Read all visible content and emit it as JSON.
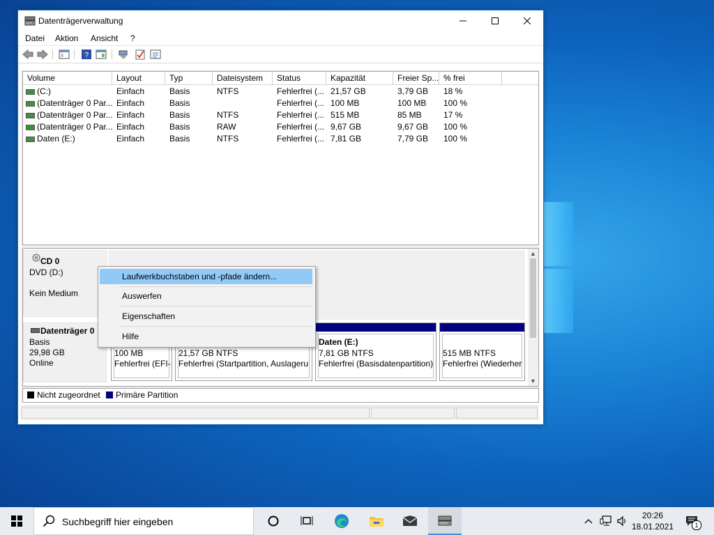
{
  "window": {
    "title": "Datenträgerverwaltung",
    "menu": [
      "Datei",
      "Aktion",
      "Ansicht",
      "?"
    ]
  },
  "volumes": {
    "columns": [
      "Volume",
      "Layout",
      "Typ",
      "Dateisystem",
      "Status",
      "Kapazität",
      "Freier Sp...",
      "% frei"
    ],
    "rows": [
      [
        "(C:)",
        "Einfach",
        "Basis",
        "NTFS",
        "Fehlerfrei (...",
        "21,57 GB",
        "3,79 GB",
        "18 %"
      ],
      [
        "(Datenträger 0 Par...",
        "Einfach",
        "Basis",
        "",
        "Fehlerfrei (...",
        "100 MB",
        "100 MB",
        "100 %"
      ],
      [
        "(Datenträger 0 Par...",
        "Einfach",
        "Basis",
        "NTFS",
        "Fehlerfrei (...",
        "515 MB",
        "85 MB",
        "17 %"
      ],
      [
        "(Datenträger 0 Par...",
        "Einfach",
        "Basis",
        "RAW",
        "Fehlerfrei (...",
        "9,67 GB",
        "9,67 GB",
        "100 %"
      ],
      [
        "Daten (E:)",
        "Einfach",
        "Basis",
        "NTFS",
        "Fehlerfrei (...",
        "7,81 GB",
        "7,79 GB",
        "100 %"
      ]
    ]
  },
  "cd": {
    "name": "CD 0",
    "type": "DVD (D:)",
    "media": "Kein Medium"
  },
  "disk0": {
    "name": "Datenträger 0",
    "type": "Basis",
    "size": "29,98 GB",
    "state": "Online",
    "partitions": [
      {
        "title": "",
        "line1": "100 MB",
        "line2": "Fehlerfrei (EFI-"
      },
      {
        "title": "",
        "line1": "21,57 GB NTFS",
        "line2": "Fehlerfrei (Startpartition, Auslageru"
      },
      {
        "title": "Daten  (E:)",
        "line1": "7,81 GB NTFS",
        "line2": "Fehlerfrei (Basisdatenpartition)"
      },
      {
        "title": "",
        "line1": "515 MB NTFS",
        "line2": "Fehlerfrei (Wiederher"
      }
    ]
  },
  "legend": {
    "unallocated": "Nicht zugeordnet",
    "primary": "Primäre Partition",
    "unallocated_color": "#000000",
    "primary_color": "#000080"
  },
  "context_menu": {
    "items": [
      "Laufwerkbuchstaben und -pfade ändern...",
      "Auswerfen",
      "Eigenschaften",
      "Hilfe"
    ],
    "highlighted": 0
  },
  "taskbar": {
    "search_placeholder": "Suchbegriff hier eingeben",
    "time": "20:26",
    "date": "18.01.2021",
    "notifications": "1"
  }
}
